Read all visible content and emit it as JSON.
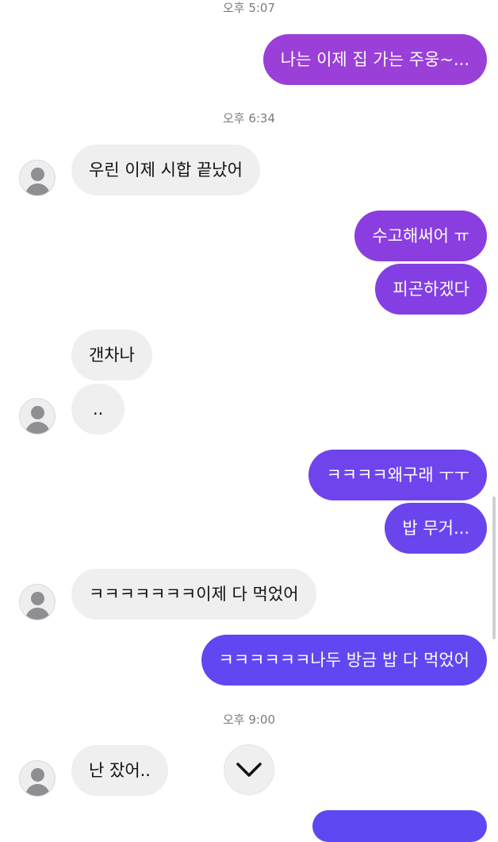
{
  "messages": [
    {
      "kind": "timestamp",
      "text": "오후 5:07"
    },
    {
      "kind": "out",
      "text": "나는 이제 집 가는 주웅~..."
    },
    {
      "kind": "timestamp",
      "text": "오후 6:34"
    },
    {
      "kind": "in",
      "text": "우린 이제 시합 끝났어"
    },
    {
      "kind": "out",
      "text": "수고해써어 ㅠ"
    },
    {
      "kind": "out",
      "text": "피곤하겠다"
    },
    {
      "kind": "in",
      "text": "갠차나"
    },
    {
      "kind": "in",
      "text": ".."
    },
    {
      "kind": "out",
      "text": "ㅋㅋㅋㅋ왜구래 ㅜㅜ"
    },
    {
      "kind": "out",
      "text": "밥 무거..."
    },
    {
      "kind": "in",
      "text": "ㅋㅋㅋㅋㅋㅋㅋ이제 다 먹었어"
    },
    {
      "kind": "out",
      "text": "ㅋㅋㅋㅋㅋㅋ나두 방금 밥 다 먹었어"
    },
    {
      "kind": "timestamp",
      "text": "오후 9:00"
    },
    {
      "kind": "in",
      "text": "난 잤어.."
    }
  ],
  "colors": {
    "outgoing_gradient": [
      "#9b3fd6",
      "#7c45e9",
      "#5f48f0"
    ],
    "incoming_bubble": "#efefef",
    "timestamp_text": "#7b7b7b",
    "avatar_placeholder": "#8e8e93"
  },
  "icons": {
    "avatar": "default-person-icon",
    "scroll": "chevron-down-icon"
  }
}
